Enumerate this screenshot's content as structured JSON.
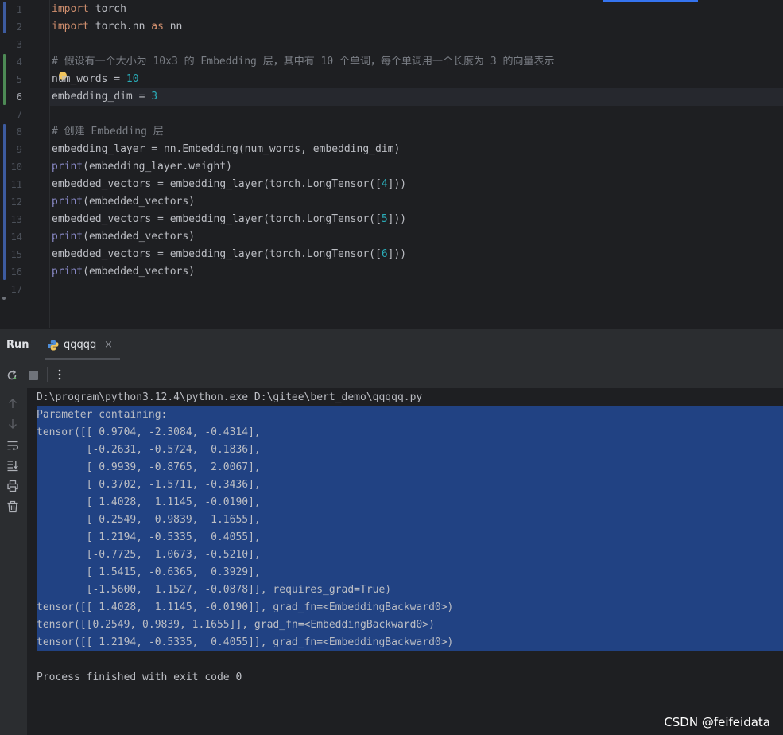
{
  "editor": {
    "line_numbers": [
      "1",
      "2",
      "3",
      "4",
      "5",
      "6",
      "7",
      "8",
      "9",
      "10",
      "11",
      "12",
      "13",
      "14",
      "15",
      "16",
      "17"
    ],
    "current_line": "6",
    "lines": [
      [
        {
          "t": "import",
          "c": "kw"
        },
        {
          "t": " torch"
        }
      ],
      [
        {
          "t": "import",
          "c": "kw"
        },
        {
          "t": " torch.nn "
        },
        {
          "t": "as",
          "c": "kw"
        },
        {
          "t": " nn"
        }
      ],
      [],
      [
        {
          "t": "# 假设有一个大小为 10x3 的 Embedding 层，其中有 10 个单词，每个单词用一个长度为 3 的向量表示",
          "c": "cmt"
        }
      ],
      [
        {
          "t": "num_words = "
        },
        {
          "t": "10",
          "c": "num"
        }
      ],
      [
        {
          "t": "embedding_dim = "
        },
        {
          "t": "3",
          "c": "num"
        }
      ],
      [],
      [
        {
          "t": "# 创建 Embedding 层",
          "c": "cmt"
        }
      ],
      [
        {
          "t": "embedding_layer = nn.Embedding(num_words, embedding_dim)"
        }
      ],
      [
        {
          "t": "print",
          "c": "fn"
        },
        {
          "t": "(embedding_layer.weight)"
        }
      ],
      [
        {
          "t": "embedded_vectors = embedding_layer(torch.LongTensor(["
        },
        {
          "t": "4",
          "c": "num"
        },
        {
          "t": "]))"
        }
      ],
      [
        {
          "t": "print",
          "c": "fn"
        },
        {
          "t": "(embedded_vectors)"
        }
      ],
      [
        {
          "t": "embedded_vectors = embedding_layer(torch.LongTensor(["
        },
        {
          "t": "5",
          "c": "num"
        },
        {
          "t": "]))"
        }
      ],
      [
        {
          "t": "print",
          "c": "fn"
        },
        {
          "t": "(embedded_vectors)"
        }
      ],
      [
        {
          "t": "embedded_vectors = embedding_layer(torch.LongTensor(["
        },
        {
          "t": "6",
          "c": "num"
        },
        {
          "t": "]))"
        }
      ],
      [
        {
          "t": "print",
          "c": "fn"
        },
        {
          "t": "(embedded_vectors)"
        }
      ],
      []
    ]
  },
  "run_panel": {
    "title": "Run",
    "tab_label": "qqqqq",
    "close_glyph": "×",
    "toolbar": {
      "rerun_icon": "rerun-icon",
      "stop_icon": "stop-icon",
      "more_icon": "more-vertical-icon"
    },
    "sidebar_icons": [
      "arrow-up-icon",
      "arrow-down-icon",
      "soft-wrap-icon",
      "scroll-to-end-icon",
      "print-icon",
      "trash-icon"
    ]
  },
  "console": {
    "lines": [
      "D:\\program\\python3.12.4\\python.exe D:\\gitee\\bert_demo\\qqqqq.py",
      "Parameter containing:",
      "tensor([[ 0.9704, -2.3084, -0.4314],",
      "        [-0.2631, -0.5724,  0.1836],",
      "        [ 0.9939, -0.8765,  2.0067],",
      "        [ 0.3702, -1.5711, -0.3436],",
      "        [ 1.4028,  1.1145, -0.0190],",
      "        [ 0.2549,  0.9839,  1.1655],",
      "        [ 1.2194, -0.5335,  0.4055],",
      "        [-0.7725,  1.0673, -0.5210],",
      "        [ 1.5415, -0.6365,  0.3929],",
      "        [-1.5600,  1.1527, -0.0878]], requires_grad=True)",
      "tensor([[ 1.4028,  1.1145, -0.0190]], grad_fn=<EmbeddingBackward0>)",
      "tensor([[0.2549, 0.9839, 1.1655]], grad_fn=<EmbeddingBackward0>)",
      "tensor([[ 1.2194, -0.5335,  0.4055]], grad_fn=<EmbeddingBackward0>)",
      "",
      "Process finished with exit code 0"
    ]
  },
  "watermark": "CSDN @feifeidata",
  "colors": {
    "background": "#1e1f22",
    "selection": "#214283",
    "keyword": "#cf8e6d",
    "number": "#2aacb8",
    "comment": "#7a7e85",
    "builtin": "#8888c6"
  }
}
